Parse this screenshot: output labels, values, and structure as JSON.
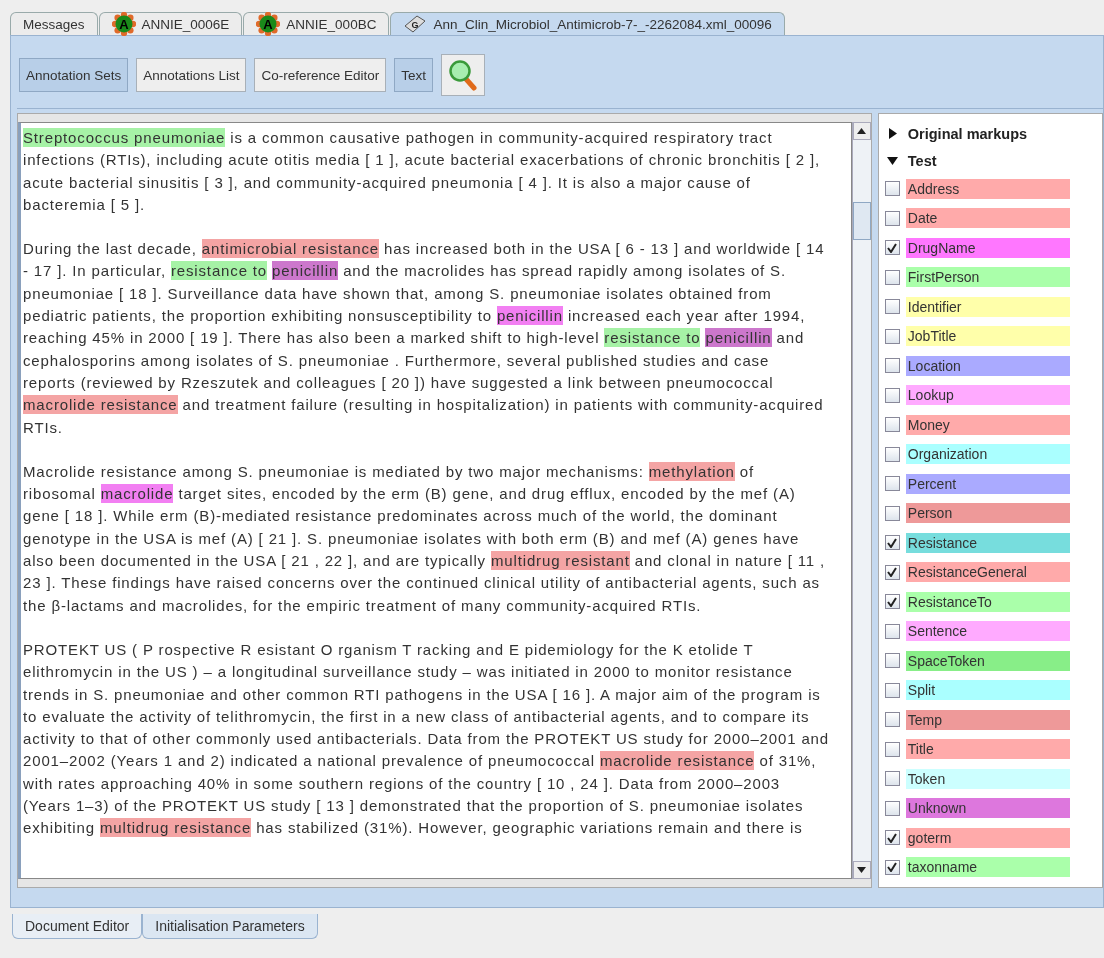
{
  "tabs": [
    {
      "label": "Messages",
      "kind": "plain",
      "selected": false
    },
    {
      "label": "ANNIE_0006E",
      "kind": "annie",
      "icon_letter": "A",
      "selected": false
    },
    {
      "label": "ANNIE_000BC",
      "kind": "annie",
      "icon_letter": "A",
      "selected": false
    },
    {
      "label": "Ann_Clin_Microbiol_Antimicrob-7-_-2262084.xml_00096",
      "kind": "document",
      "icon_letter": "G",
      "selected": true
    }
  ],
  "toolbar": [
    {
      "label": "Annotation Sets",
      "kind": "text",
      "selected": true
    },
    {
      "label": "Annotations List",
      "kind": "text",
      "selected": false
    },
    {
      "label": "Co-reference Editor",
      "kind": "text",
      "selected": false
    },
    {
      "label": "Text",
      "kind": "text",
      "selected": true
    },
    {
      "kind": "search",
      "selected": false
    }
  ],
  "document": {
    "paragraphs": [
      [
        [
          {
            "text": "Streptococcus pneumoniae",
            "color": "#a6f2a6"
          },
          " is a common causative pathogen in community-acquired respiratory tract"
        ],
        [
          "infections (RTIs), including acute otitis media [ 1 ], acute bacterial exacerbations of chronic bronchitis [ 2 ],"
        ],
        [
          "acute bacterial sinusitis [ 3 ], and community-acquired pneumonia [ 4 ]. It is also a major cause of"
        ],
        [
          "bacteremia [ 5 ]."
        ]
      ],
      [
        [
          "During the last decade, ",
          {
            "text": "antimicrobial resistance",
            "color": "#f4a4a4"
          },
          " has increased both in the USA [ 6 - 13 ] and worldwide [ 14"
        ],
        [
          "- 17 ]. In particular, ",
          {
            "text": "resistance to",
            "color": "#a6f2a6"
          },
          {
            "text": "penicillin",
            "color": "#cc77cc"
          },
          " and the macrolides has spread rapidly among isolates of S."
        ],
        [
          "pneumoniae [ 18 ]. Surveillance data have shown that, among S. pneumoniae isolates obtained from"
        ],
        [
          "pediatric patients, the proportion exhibiting nonsusceptibility to ",
          {
            "text": "penicillin",
            "color": "#f27ff2"
          },
          " increased each year after 1994,"
        ],
        [
          "reaching 45% in 2000 [ 19 ]. There has also been a marked shift to high-level ",
          {
            "text": "resistance to",
            "color": "#a6f2a6"
          },
          {
            "text": "penicillin",
            "color": "#cc77cc"
          },
          " and"
        ],
        [
          "cephalosporins among isolates of S. pneumoniae . Furthermore, several published studies and case"
        ],
        [
          "reports (reviewed by Rzeszutek and colleagues [ 20 ]) have suggested a link between pneumococcal"
        ],
        [
          {
            "text": "macrolide resistance",
            "color": "#f4a4a4"
          },
          " and treatment failure (resulting in hospitalization) in patients with community-acquired"
        ],
        [
          "RTIs."
        ]
      ],
      [
        [
          "Macrolide resistance among S. pneumoniae is mediated by two major mechanisms: ",
          {
            "text": "methylation",
            "color": "#f4a4a4"
          },
          " of"
        ],
        [
          "ribosomal ",
          {
            "text": "macrolide",
            "color": "#f27ff2"
          },
          " target sites, encoded by the erm (B) gene, and drug efflux, encoded by the mef (A)"
        ],
        [
          "gene [ 18 ]. While erm (B)-mediated resistance predominates across much of the world, the dominant"
        ],
        [
          "genotype in the USA is mef (A) [ 21 ]. S. pneumoniae isolates with both erm (B) and mef (A) genes have"
        ],
        [
          "also been documented in the USA [ 21 , 22 ], and are typically ",
          {
            "text": "multidrug resistant",
            "color": "#f4a4a4"
          },
          " and clonal in nature [ 11 ,"
        ],
        [
          "23 ]. These findings have raised concerns over the continued clinical utility of antibacterial agents, such as"
        ],
        [
          "the β-lactams and macrolides, for the empiric treatment of many community-acquired RTIs."
        ]
      ],
      [
        [
          "PROTEKT US ( P rospective R esistant O rganism T racking and E pidemiology for the K etolide T"
        ],
        [
          "elithromycin in the US ) – a longitudinal surveillance study – was initiated in 2000 to monitor resistance"
        ],
        [
          "trends in S. pneumoniae and other common RTI pathogens in the USA [ 16 ]. A major aim of the program is"
        ],
        [
          "to evaluate the activity of telithromycin, the first in a new class of antibacterial agents, and to compare its"
        ],
        [
          "activity to that of other commonly used antibacterials. Data from the PROTEKT US study for 2000–2001 and"
        ],
        [
          "2001–2002 (Years 1 and 2) indicated a national prevalence of pneumococcal ",
          {
            "text": "macrolide resistance",
            "color": "#f4a4a4"
          },
          " of 31%,"
        ],
        [
          "with rates approaching 40% in some southern regions of the country [ 10 , 24 ]. Data from 2000–2003"
        ],
        [
          "(Years 1–3) of the PROTEKT US study [ 13 ] demonstrated that the proportion of S. pneumoniae isolates"
        ],
        [
          "exhibiting ",
          {
            "text": "multidrug resistance",
            "color": "#f4a4a4"
          },
          " has stabilized (31%). However, geographic variations remain and there is"
        ]
      ]
    ]
  },
  "annotation_sets": [
    {
      "label": "Original markups",
      "expanded": false
    },
    {
      "label": "Test",
      "expanded": true,
      "children": [
        {
          "label": "Address",
          "checked": false,
          "color": "#ffaaaa"
        },
        {
          "label": "Date",
          "checked": false,
          "color": "#ffaaaa"
        },
        {
          "label": "DrugName",
          "checked": true,
          "color": "#ff77ff"
        },
        {
          "label": "FirstPerson",
          "checked": false,
          "color": "#aaffaa"
        },
        {
          "label": "Identifier",
          "checked": false,
          "color": "#ffffaa"
        },
        {
          "label": "JobTitle",
          "checked": false,
          "color": "#ffffaa"
        },
        {
          "label": "Location",
          "checked": false,
          "color": "#aaaaff"
        },
        {
          "label": "Lookup",
          "checked": false,
          "color": "#ffaaff"
        },
        {
          "label": "Money",
          "checked": false,
          "color": "#ffaaaa"
        },
        {
          "label": "Organization",
          "checked": false,
          "color": "#aaffff"
        },
        {
          "label": "Percent",
          "checked": false,
          "color": "#aaaaff"
        },
        {
          "label": "Person",
          "checked": false,
          "color": "#ee9999"
        },
        {
          "label": "Resistance",
          "checked": true,
          "color": "#77dddd"
        },
        {
          "label": "ResistanceGeneral",
          "checked": true,
          "color": "#ffaaaa"
        },
        {
          "label": "ResistanceTo",
          "checked": true,
          "color": "#aaffaa"
        },
        {
          "label": "Sentence",
          "checked": false,
          "color": "#ffaaff"
        },
        {
          "label": "SpaceToken",
          "checked": false,
          "color": "#88ee88"
        },
        {
          "label": "Split",
          "checked": false,
          "color": "#aaffff"
        },
        {
          "label": "Temp",
          "checked": false,
          "color": "#ee9999"
        },
        {
          "label": "Title",
          "checked": false,
          "color": "#ffaaaa"
        },
        {
          "label": "Token",
          "checked": false,
          "color": "#ccffff"
        },
        {
          "label": "Unknown",
          "checked": false,
          "color": "#dd77dd"
        },
        {
          "label": "goterm",
          "checked": true,
          "color": "#ffaaaa"
        },
        {
          "label": "taxonname",
          "checked": true,
          "color": "#aaffaa"
        }
      ]
    }
  ],
  "bottom_tabs": [
    {
      "label": "Document Editor",
      "selected": true
    },
    {
      "label": "Initialisation Parameters",
      "selected": false
    }
  ]
}
